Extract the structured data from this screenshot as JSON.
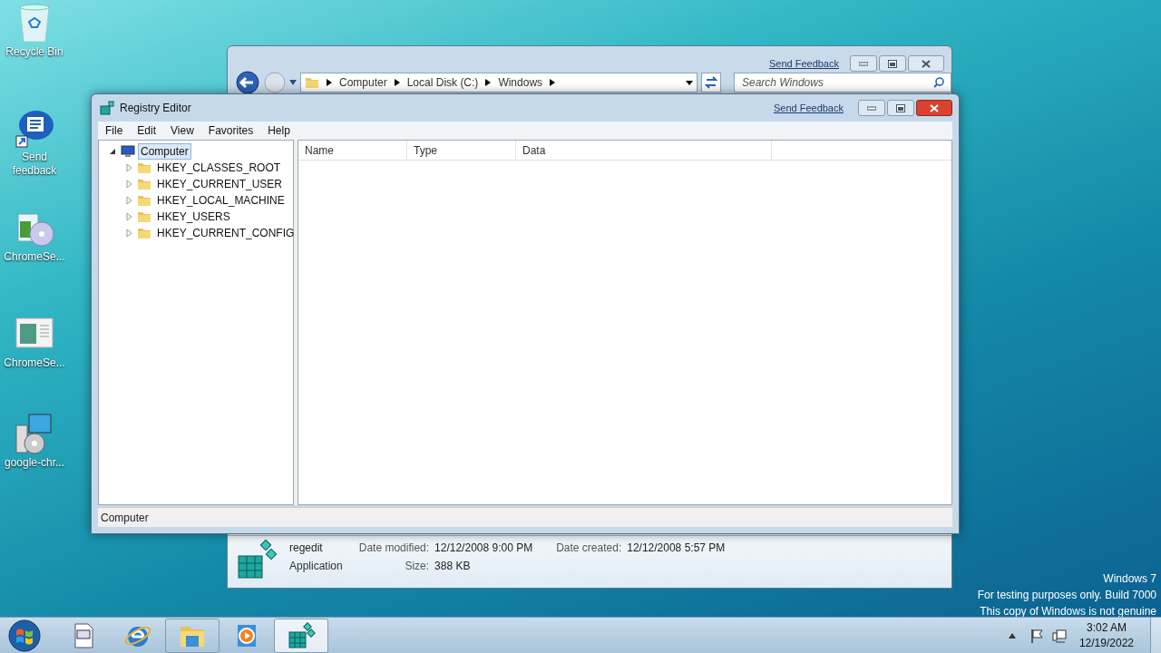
{
  "desktop_icons": [
    {
      "kind": "bin",
      "label": "Recycle Bin"
    },
    {
      "kind": "feedback",
      "label": "Send feedback"
    },
    {
      "kind": "setup",
      "label": "ChromeSe..."
    },
    {
      "kind": "window",
      "label": "ChromeSe..."
    },
    {
      "kind": "installer",
      "label": "google-chr..."
    }
  ],
  "explorer": {
    "send_feedback": "Send Feedback",
    "breadcrumb": [
      "Computer",
      "Local Disk (C:)",
      "Windows"
    ],
    "search": {
      "placeholder": "Search Windows"
    },
    "details": {
      "name": "regedit",
      "type": "Application",
      "fields": [
        {
          "label": "Date modified:",
          "value": "12/12/2008 9:00 PM"
        },
        {
          "label": "Date created:",
          "value": "12/12/2008 5:57 PM"
        },
        {
          "label": "Size:",
          "value": "388 KB"
        }
      ]
    }
  },
  "registry_editor": {
    "title": "Registry Editor",
    "send_feedback": "Send Feedback",
    "menu": [
      "File",
      "Edit",
      "View",
      "Favorites",
      "Help"
    ],
    "tree": [
      {
        "label": "Computer",
        "expanded": true,
        "selected": true,
        "children": [
          {
            "label": "HKEY_CLASSES_ROOT",
            "expanded": false,
            "selected": false
          },
          {
            "label": "HKEY_CURRENT_USER",
            "expanded": false,
            "selected": false
          },
          {
            "label": "HKEY_LOCAL_MACHINE",
            "expanded": false,
            "selected": false
          },
          {
            "label": "HKEY_USERS",
            "expanded": false,
            "selected": false
          },
          {
            "label": "HKEY_CURRENT_CONFIG",
            "expanded": false,
            "selected": false
          }
        ]
      }
    ],
    "columns": [
      "Name",
      "Type",
      "Data"
    ],
    "status_bar": "Computer"
  },
  "watermark_lines": [
    "Windows 7",
    "For testing purposes only. Build 7000",
    "This copy of Windows is not genuine"
  ],
  "taskbar": {
    "items": [
      {
        "kind": "document",
        "running": false,
        "active": false
      },
      {
        "kind": "browser",
        "running": false,
        "active": false
      },
      {
        "kind": "folder",
        "running": true,
        "active": false
      },
      {
        "kind": "media",
        "running": false,
        "active": false
      },
      {
        "kind": "cubes",
        "running": true,
        "active": true
      }
    ],
    "time": "3:02 AM",
    "date": "12/19/2022"
  }
}
